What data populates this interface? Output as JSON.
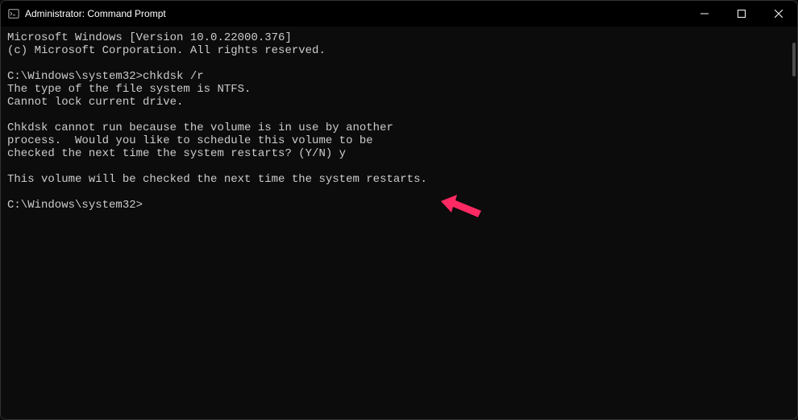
{
  "titlebar": {
    "title": "Administrator: Command Prompt"
  },
  "terminal": {
    "lines": [
      "Microsoft Windows [Version 10.0.22000.376]",
      "(c) Microsoft Corporation. All rights reserved.",
      "",
      "C:\\Windows\\system32>chkdsk /r",
      "The type of the file system is NTFS.",
      "Cannot lock current drive.",
      "",
      "Chkdsk cannot run because the volume is in use by another",
      "process.  Would you like to schedule this volume to be",
      "checked the next time the system restarts? (Y/N) y",
      "",
      "This volume will be checked the next time the system restarts.",
      "",
      "C:\\Windows\\system32>"
    ]
  },
  "annotation": {
    "arrow_color": "#ff2b63"
  }
}
